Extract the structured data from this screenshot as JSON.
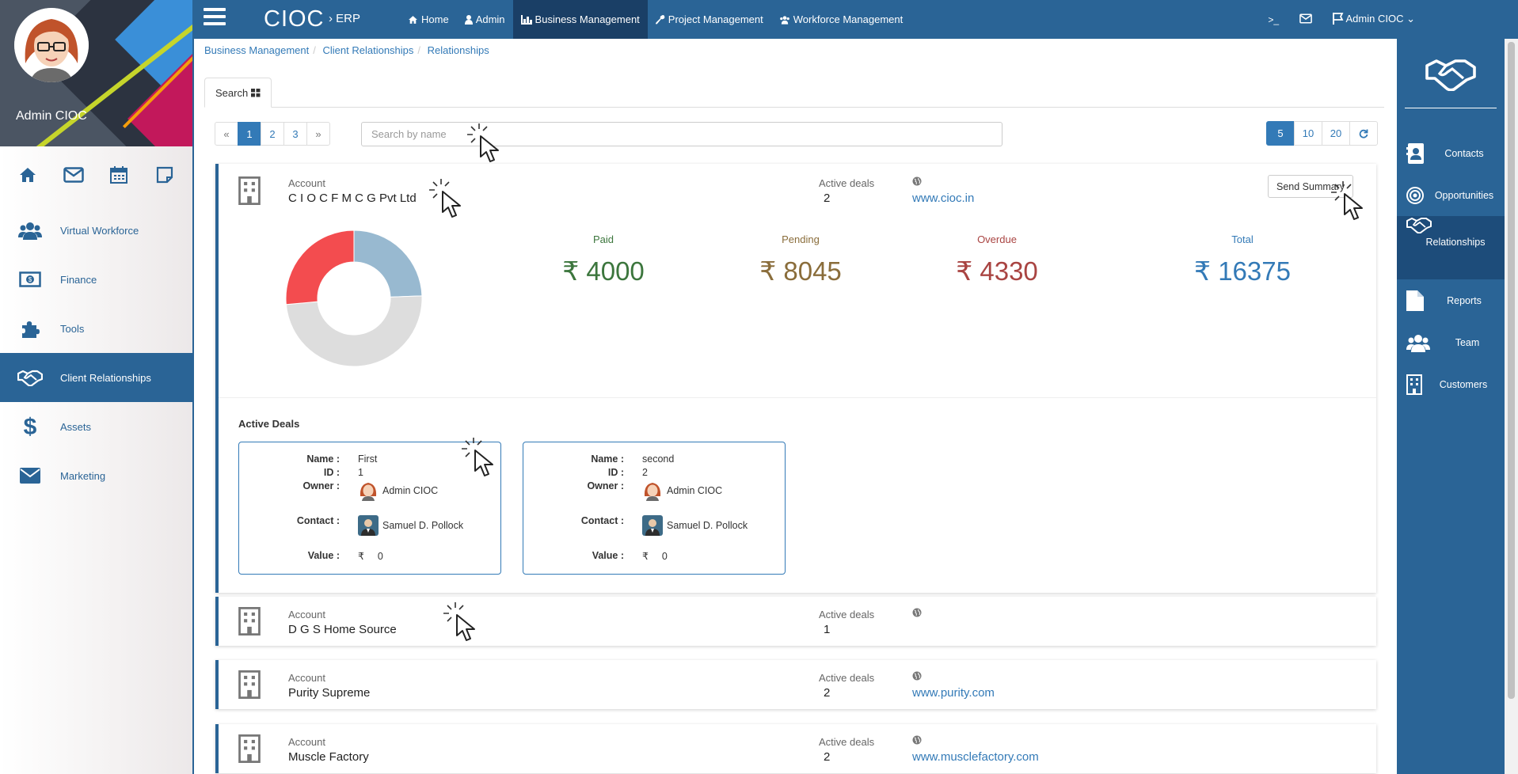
{
  "app": {
    "brand": "CIOC",
    "brand_sub": "ERP",
    "user": "Admin CIOC"
  },
  "topnav": [
    {
      "label": "Home"
    },
    {
      "label": "Admin"
    },
    {
      "label": "Business Management"
    },
    {
      "label": "Project Management"
    },
    {
      "label": "Workforce Management"
    }
  ],
  "topright": {
    "terminal": ">_",
    "user_menu": "Admin CIOC"
  },
  "left_nav": [
    {
      "label": "Virtual Workforce",
      "icon": "users-icon"
    },
    {
      "label": "Finance",
      "icon": "money-icon"
    },
    {
      "label": "Tools",
      "icon": "puzzle-icon"
    },
    {
      "label": "Client Relationships",
      "icon": "handshake-icon"
    },
    {
      "label": "Assets",
      "icon": "dollar-icon"
    },
    {
      "label": "Marketing",
      "icon": "envelope-icon"
    }
  ],
  "right_nav": [
    {
      "label": "Contacts",
      "icon": "address-book-icon"
    },
    {
      "label": "Opportunities",
      "icon": "target-icon"
    },
    {
      "label": "Relationships",
      "icon": "handshake-icon"
    },
    {
      "label": "Reports",
      "icon": "file-icon"
    },
    {
      "label": "Team",
      "icon": "users-icon"
    },
    {
      "label": "Customers",
      "icon": "building-icon"
    }
  ],
  "breadcrumb": [
    "Business Management",
    "Client Relationships",
    "Relationships"
  ],
  "tab": {
    "label": "Search"
  },
  "pagination": {
    "first": "«",
    "pages": [
      "1",
      "2",
      "3"
    ],
    "last": "»",
    "current": "1"
  },
  "search": {
    "placeholder": "Search by name",
    "value": ""
  },
  "page_sizes": [
    "5",
    "10",
    "20"
  ],
  "labels": {
    "account": "Account",
    "active_deals": "Active deals",
    "send_summary": "Send Summary",
    "active_deals_title": "Active Deals",
    "name": "Name :",
    "id": "ID :",
    "owner": "Owner :",
    "contact": "Contact :",
    "value": "Value :"
  },
  "expanded_account": {
    "name": "C I O C F M C G Pvt Ltd",
    "active_deals": "2",
    "website": "www.cioc.in",
    "summary": {
      "paid": {
        "label": "Paid",
        "value": "₹ 4000",
        "amount": 4000,
        "color": "#3c763d"
      },
      "pending": {
        "label": "Pending",
        "value": "₹ 8045",
        "amount": 8045,
        "color": "#8a6d3b"
      },
      "overdue": {
        "label": "Overdue",
        "value": "₹ 4330",
        "amount": 4330,
        "color": "#a94442"
      },
      "total": {
        "label": "Total",
        "value": "₹ 16375",
        "amount": 16375,
        "color": "#31708f"
      }
    },
    "donut_colors": [
      "#98b9d0",
      "#dddddd",
      "#f34c4f"
    ],
    "deals": [
      {
        "name": "First",
        "id": "1",
        "owner": "Admin CIOC",
        "contact": "Samuel D. Pollock",
        "currency": "₹",
        "value": "0"
      },
      {
        "name": "second",
        "id": "2",
        "owner": "Admin CIOC",
        "contact": "Samuel D. Pollock",
        "currency": "₹",
        "value": "0"
      }
    ]
  },
  "accounts": [
    {
      "name": "D G S Home Source",
      "active_deals": "1",
      "website": ""
    },
    {
      "name": "Purity Supreme",
      "active_deals": "2",
      "website": "www.purity.com"
    },
    {
      "name": "Muscle Factory",
      "active_deals": "2",
      "website": "www.musclefactory.com"
    }
  ]
}
